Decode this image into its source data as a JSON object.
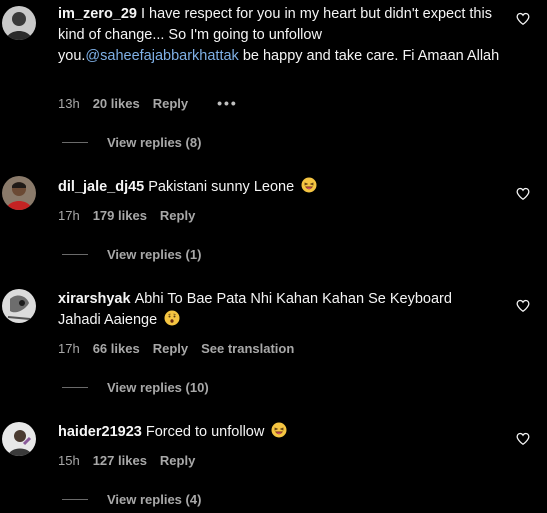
{
  "comments": [
    {
      "username": "im_zero_29",
      "text_before": "I have respect for you in my heart but didn't expect this kind of change... So I'm going to unfollow you.",
      "mention": "@saheefajabbarkhattak",
      "text_after": " be happy and take care. Fi Amaan Allah",
      "time": "13h",
      "likes": "20 likes",
      "reply": "Reply",
      "more": "•••",
      "view_replies": "View replies (8)"
    },
    {
      "username": "dil_jale_dj45",
      "text": "Pakistani sunny Leone",
      "emoji": "laughing-face",
      "time": "17h",
      "likes": "179 likes",
      "reply": "Reply",
      "view_replies": "View replies (1)"
    },
    {
      "username": "xirarshyak",
      "text": "Abhi To Bae Pata Nhi Kahan Kahan Se Keyboard Jahadi Aaienge",
      "emoji": "hushed-face",
      "time": "17h",
      "likes": "66 likes",
      "reply": "Reply",
      "translation": "See translation",
      "view_replies": "View replies (10)"
    },
    {
      "username": "haider21923",
      "text": "Forced to unfollow",
      "emoji": "laughing-face",
      "time": "15h",
      "likes": "127 likes",
      "reply": "Reply",
      "view_replies": "View replies (4)"
    }
  ],
  "colors": {
    "background": "#000000",
    "text": "#f5f5f5",
    "muted": "#a8a8a8",
    "mention": "#7fb0e6"
  }
}
